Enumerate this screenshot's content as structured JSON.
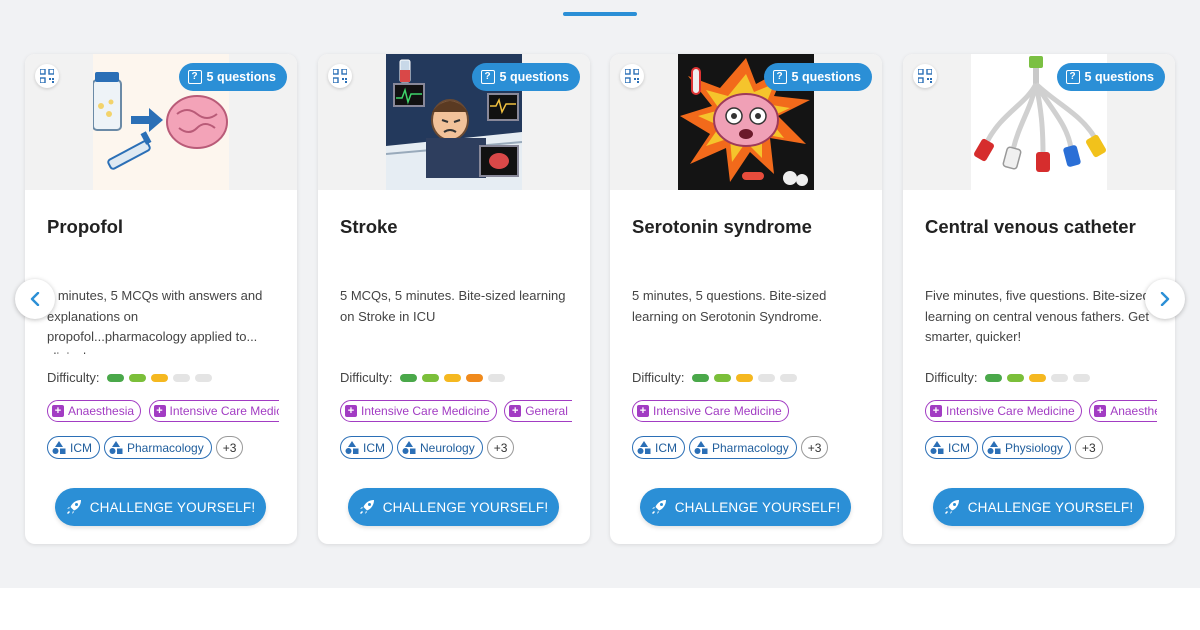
{
  "cards": [
    {
      "badge": "5 questions",
      "title": "Propofol",
      "description": "5 minutes, 5 MCQs with answers and explanations on propofol...pharmacology applied to... clinical scene",
      "difficulty_label": "Difficulty:",
      "difficulty_pills": [
        "#4aa84a",
        "#7bbf3a",
        "#f5b820",
        "#e4e4e4",
        "#e4e4e4"
      ],
      "specialties": [
        "Anaesthesia",
        "Intensive Care Medic"
      ],
      "topics": [
        "ICM",
        "Pharmacology"
      ],
      "more": "+3",
      "cta": "CHALLENGE YOURSELF!"
    },
    {
      "badge": "5 questions",
      "title": "Stroke",
      "description": "5 MCQs, 5 minutes. Bite-sized learning on Stroke in ICU",
      "difficulty_label": "Difficulty:",
      "difficulty_pills": [
        "#4aa84a",
        "#7bbf3a",
        "#f5b820",
        "#f08a1c",
        "#e4e4e4"
      ],
      "specialties": [
        "Intensive Care Medicine",
        "General I"
      ],
      "topics": [
        "ICM",
        "Neurology"
      ],
      "more": "+3",
      "cta": "CHALLENGE YOURSELF!"
    },
    {
      "badge": "5 questions",
      "title": "Serotonin syndrome",
      "description": "5 minutes, 5 questions. Bite-sized learning on Serotonin Syndrome.",
      "difficulty_label": "Difficulty:",
      "difficulty_pills": [
        "#4aa84a",
        "#7bbf3a",
        "#f5b820",
        "#e4e4e4",
        "#e4e4e4"
      ],
      "specialties": [
        "Intensive Care Medicine"
      ],
      "topics": [
        "ICM",
        "Pharmacology"
      ],
      "more": "+3",
      "cta": "CHALLENGE YOURSELF!"
    },
    {
      "badge": "5 questions",
      "title": "Central venous catheter",
      "description": "Five minutes, five questions. Bite-sized learning on central venous fathers. Get smarter, quicker!",
      "difficulty_label": "Difficulty:",
      "difficulty_pills": [
        "#4aa84a",
        "#7bbf3a",
        "#f5b820",
        "#e4e4e4",
        "#e4e4e4"
      ],
      "specialties": [
        "Intensive Care Medicine",
        "Anaesthe"
      ],
      "topics": [
        "ICM",
        "Physiology"
      ],
      "more": "+3",
      "cta": "CHALLENGE YOURSELF!"
    }
  ],
  "icons": {
    "qr": "qr-code-icon",
    "badge": "question-box-icon",
    "specialty": "plus-square-icon",
    "topic": "shapes-icon",
    "cta": "rocket-icon",
    "prev": "chevron-left-icon",
    "next": "chevron-right-icon"
  },
  "colors": {
    "accent": "#2b8fd6",
    "specialty": "#a23cc3",
    "topic": "#1f5d9c",
    "band": "#f1f2f4"
  }
}
